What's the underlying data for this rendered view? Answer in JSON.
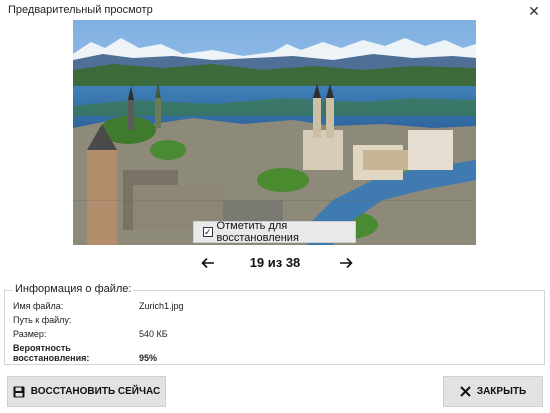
{
  "window": {
    "title": "Предварительный просмотр",
    "close_icon": "close-icon"
  },
  "preview": {
    "image_description_icon": "photo-preview",
    "mark_for_restore_label": "Отметить для восстановления",
    "mark_for_restore_checked": true
  },
  "navigation": {
    "prev_icon": "arrow-left-icon",
    "next_icon": "arrow-right-icon",
    "counter": "19 из 38"
  },
  "file_info": {
    "legend": "Информация о файле:",
    "name_label": "Имя файла:",
    "name_value": "Zurich1.jpg",
    "path_label": "Путь к файлу:",
    "path_value": "",
    "size_label": "Размер:",
    "size_value": "540 КБ",
    "probability_label": "Вероятность восстановления:",
    "probability_value": "95%"
  },
  "buttons": {
    "restore_now": "ВОССТАНОВИТЬ СЕЙЧАС",
    "restore_icon": "floppy-disk-icon",
    "close": "ЗАКРЫТЬ",
    "close_icon": "close-x-icon"
  },
  "colors": {
    "sky": "#9ec4ea",
    "lake": "#3e7fb8",
    "mountains": "#eef2f7",
    "city": "#c9bfae",
    "button_bg": "#e2e2e2"
  }
}
